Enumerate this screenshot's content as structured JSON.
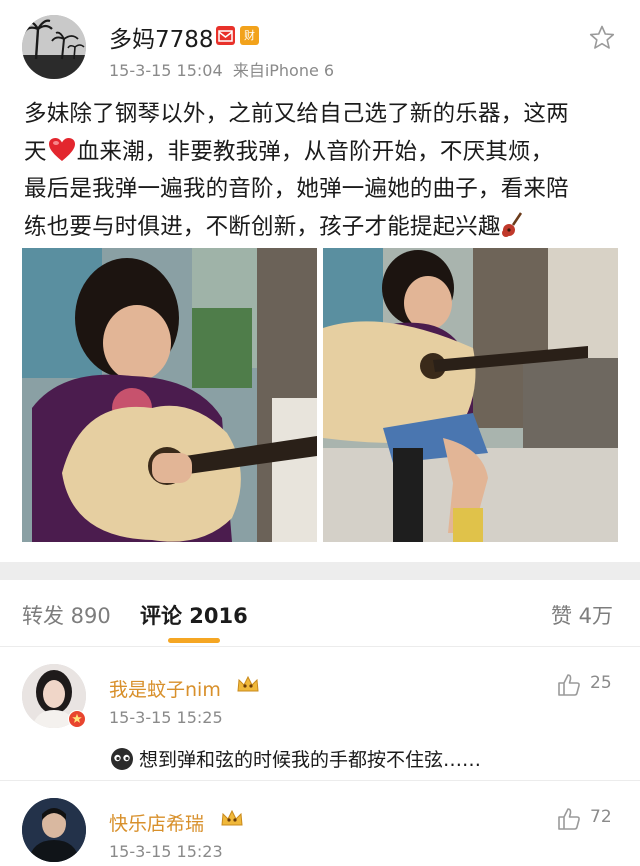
{
  "post": {
    "author": "多妈7788",
    "badges": [
      {
        "icon": "envelope-badge-icon",
        "text": "",
        "color": "#e8312a"
      },
      {
        "icon": "wealth-badge-icon",
        "text": "财",
        "color": "#f2a21b"
      }
    ],
    "timestamp": "15-3-15 15:04",
    "source": "来自iPhone 6",
    "lines": [
      "多妹除了钢琴以外，之前又给自己选了新的乐器，这两",
      {
        "before": "天",
        "emoji": "heart-emoji-icon",
        "after": "血来潮，非要教我弹，从音阶开始，不厌其烦，"
      },
      "最后是我弹一遍我的音阶，她弹一遍她的曲子，看来陪",
      {
        "before": "练也要与时俱进，不断创新，孩子才能提起兴趣",
        "emoji": "guitar-emoji-icon",
        "after": ""
      }
    ]
  },
  "stats": {
    "repost_label": "转发 890",
    "comment_label": "评论 2016",
    "like_label": "赞 4万"
  },
  "comments": [
    {
      "name": "我是蚊子nim",
      "timestamp": "15-3-15 15:25",
      "text": "想到弹和弦的时候我的手都按不住弦……",
      "likes": "25"
    },
    {
      "name": "快乐店希瑞",
      "timestamp": "15-3-15 15:23",
      "text": "",
      "likes": "72"
    }
  ],
  "colors": {
    "accent": "#f5a623",
    "username": "#d8902b"
  }
}
